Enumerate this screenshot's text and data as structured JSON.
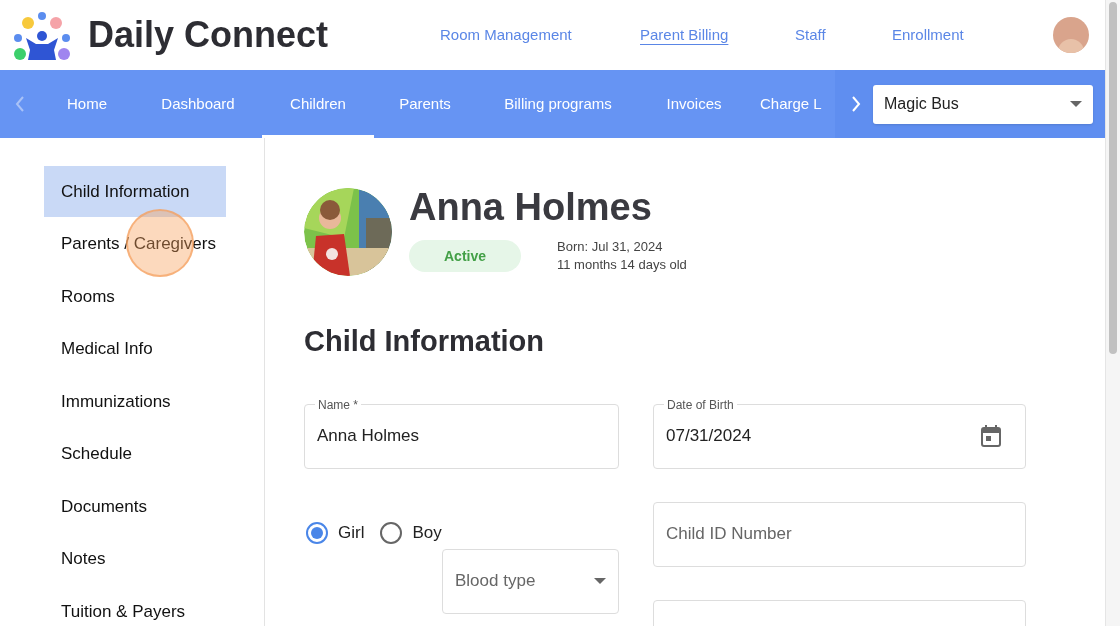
{
  "app": {
    "brand": "Daily Connect"
  },
  "top_links": [
    {
      "label": "Room Management",
      "selected": false
    },
    {
      "label": "Parent Billing",
      "selected": true
    },
    {
      "label": "Staff",
      "selected": false
    },
    {
      "label": "Enrollment",
      "selected": false
    }
  ],
  "nav_tabs": [
    {
      "label": "Home",
      "selected": false
    },
    {
      "label": "Dashboard",
      "selected": false
    },
    {
      "label": "Children",
      "selected": true
    },
    {
      "label": "Parents",
      "selected": false
    },
    {
      "label": "Billing programs",
      "selected": false
    },
    {
      "label": "Invoices",
      "selected": false
    },
    {
      "label": "Charge L",
      "selected": false
    }
  ],
  "school_select": {
    "value": "Magic Bus"
  },
  "sidebar": {
    "items": [
      {
        "label": "Child Information",
        "selected": true
      },
      {
        "label": "Parents / Caregivers",
        "selected": false
      },
      {
        "label": "Rooms",
        "selected": false
      },
      {
        "label": "Medical Info",
        "selected": false
      },
      {
        "label": "Immunizations",
        "selected": false
      },
      {
        "label": "Schedule",
        "selected": false
      },
      {
        "label": "Documents",
        "selected": false
      },
      {
        "label": "Notes",
        "selected": false
      },
      {
        "label": "Tuition & Payers",
        "selected": false
      }
    ]
  },
  "child": {
    "name": "Anna Holmes",
    "status": "Active",
    "born": "Born: Jul 31, 2024",
    "age": "11 months 14 days old"
  },
  "section_title": "Child Information",
  "form": {
    "name_field": {
      "label": "Name *",
      "value": "Anna Holmes"
    },
    "dob_field": {
      "label": "Date of Birth",
      "value": "07/31/2024"
    },
    "gender": [
      {
        "label": "Girl",
        "selected": true
      },
      {
        "label": "Boy",
        "selected": false
      }
    ],
    "blood_type": {
      "placeholder": "Blood type"
    },
    "child_id": {
      "placeholder": "Child ID Number"
    }
  }
}
